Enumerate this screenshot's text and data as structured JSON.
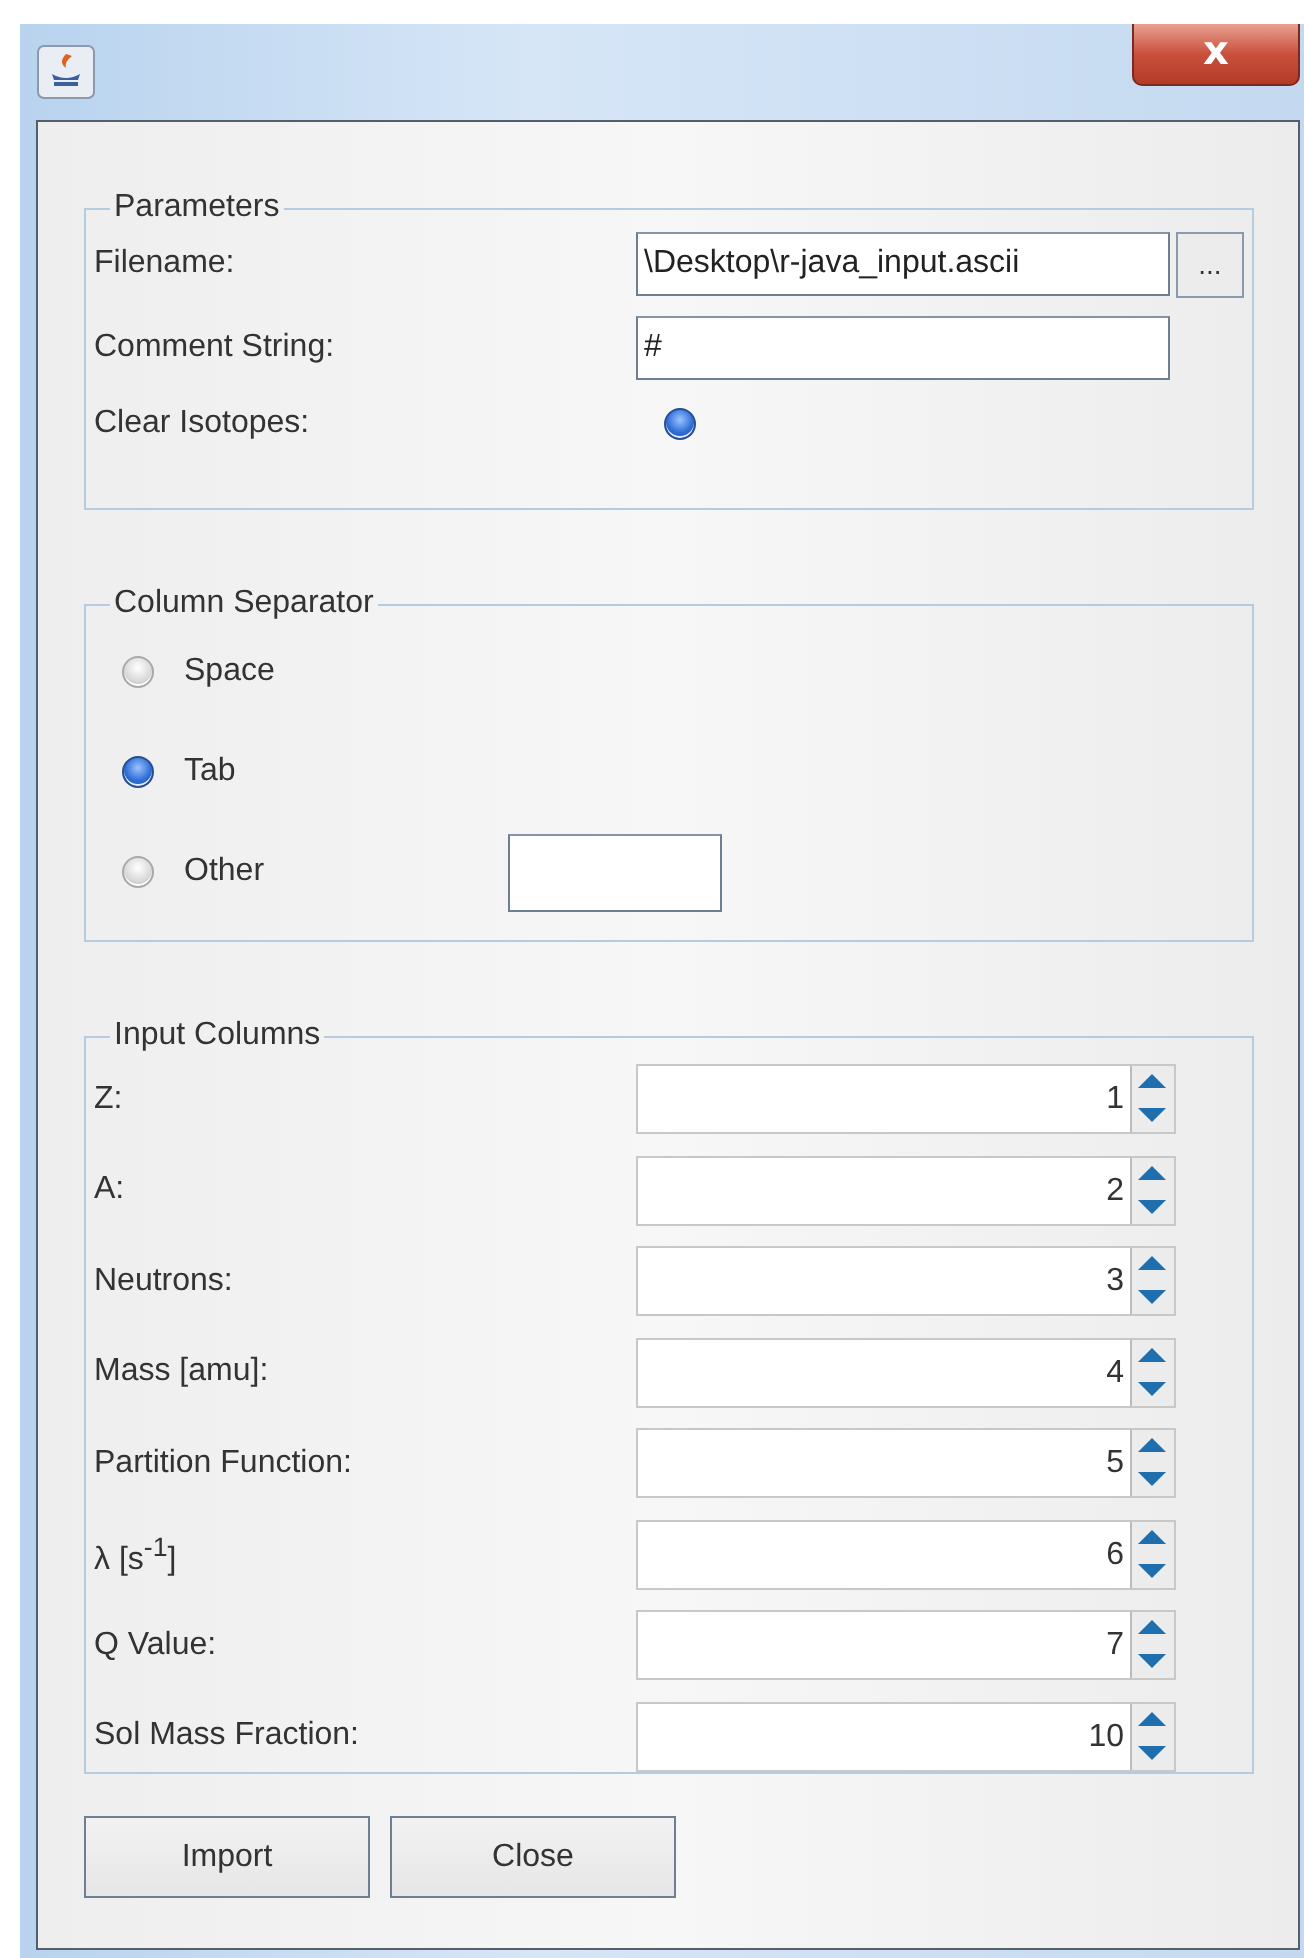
{
  "window": {
    "close_label": "x"
  },
  "parameters": {
    "title": "Parameters",
    "filename": {
      "label": "Filename:",
      "value": "\\Desktop\\r-java_input.ascii",
      "browse_label": "..."
    },
    "comment": {
      "label": "Comment String:",
      "value": "#"
    },
    "clear_isotopes": {
      "label": "Clear Isotopes:",
      "selected": true
    }
  },
  "column_separator": {
    "title": "Column Separator",
    "options": [
      {
        "label": "Space",
        "selected": false
      },
      {
        "label": "Tab",
        "selected": true
      },
      {
        "label": "Other",
        "selected": false,
        "has_field": true
      }
    ]
  },
  "input_columns": {
    "title": "Input Columns",
    "rows": [
      {
        "label": "Z:",
        "value": "1"
      },
      {
        "label": "A:",
        "value": "2"
      },
      {
        "label": "Neutrons:",
        "value": "3"
      },
      {
        "label": "Mass [amu]:",
        "value": "4"
      },
      {
        "label": "Partition Function:",
        "value": "5"
      },
      {
        "label": "λ [s$^{-1}$]",
        "value": "6"
      },
      {
        "label": "Q Value:",
        "value": "7"
      },
      {
        "label": "Sol Mass Fraction:",
        "value": "10"
      }
    ]
  },
  "buttons": [
    "Import",
    "Close"
  ]
}
